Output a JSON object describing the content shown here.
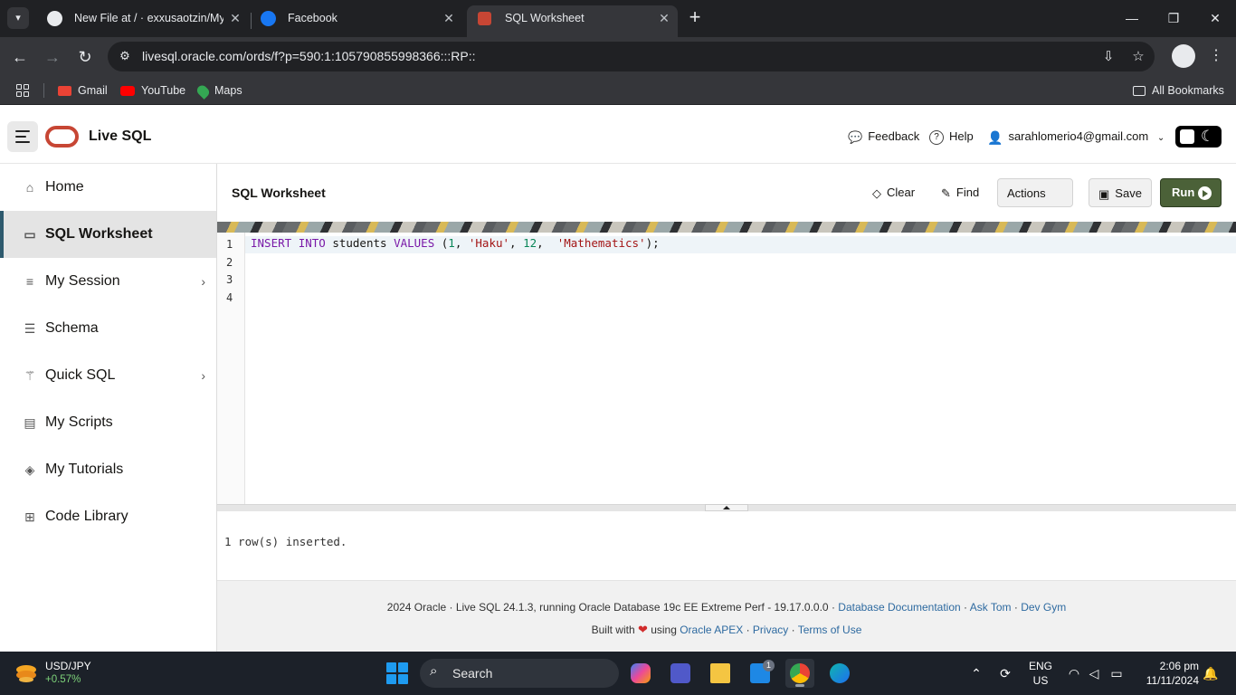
{
  "browser": {
    "tabs": [
      {
        "title": "New File at / · exxusaotzin/My-I",
        "icon": "github-icon"
      },
      {
        "title": "Facebook",
        "icon": "facebook-icon"
      },
      {
        "title": "SQL Worksheet",
        "icon": "terminal-icon",
        "active": true
      }
    ],
    "url": "livesql.oracle.com/ords/f?p=590:1:105790855998366:::RP::",
    "bookmarks": [
      "Gmail",
      "YouTube",
      "Maps"
    ],
    "all_bookmarks": "All Bookmarks"
  },
  "header": {
    "app_title": "Live SQL",
    "feedback": "Feedback",
    "help": "Help",
    "user": "sarahlomerio4@gmail.com"
  },
  "sidebar": {
    "items": [
      {
        "label": "Home",
        "icon": "home-icon"
      },
      {
        "label": "SQL Worksheet",
        "icon": "terminal-icon",
        "active": true
      },
      {
        "label": "My Session",
        "icon": "list-icon",
        "expandable": true
      },
      {
        "label": "Schema",
        "icon": "database-icon"
      },
      {
        "label": "Quick SQL",
        "icon": "wand-icon",
        "expandable": true
      },
      {
        "label": "My Scripts",
        "icon": "script-icon"
      },
      {
        "label": "My Tutorials",
        "icon": "graduation-icon"
      },
      {
        "label": "Code Library",
        "icon": "library-icon"
      }
    ]
  },
  "worksheet": {
    "title": "SQL Worksheet",
    "clear": "Clear",
    "find": "Find",
    "actions": "Actions",
    "save": "Save",
    "run": "Run",
    "line_numbers": [
      "1",
      "2",
      "3",
      "4"
    ],
    "code_tokens": {
      "insert": "INSERT",
      "into": "INTO",
      "table": " students ",
      "values": "VALUES",
      "open": " (",
      "n1": "1",
      "c1": ", ",
      "s1": "'Haku'",
      "c2": ", ",
      "n2": "12",
      "c3": ",  ",
      "s2": "'Mathematics'",
      "close": ");"
    },
    "output": "1 row(s) inserted."
  },
  "footer": {
    "line1": "2024 Oracle · Live SQL 24.1.3, running Oracle Database 19c EE Extreme Perf - 19.17.0.0.0 · ",
    "link_docs": "Database Documentation",
    "sep": " · ",
    "link_asktom": "Ask Tom",
    "link_devgym": "Dev Gym",
    "built_with": "Built with ",
    "using": " using ",
    "link_apex": "Oracle APEX",
    "link_privacy": "Privacy",
    "link_terms": "Terms of Use"
  },
  "taskbar": {
    "ticker_symbol": "USD/JPY",
    "ticker_change": "+0.57%",
    "search": "Search",
    "mail_badge": "1",
    "lang_top": "ENG",
    "lang_bottom": "US",
    "time": "2:06 pm",
    "date": "11/11/2024"
  },
  "colors": {
    "oracle_red": "#c74634",
    "run_green": "#4b6138",
    "sidebar_active_accent": "#2e5a6e"
  }
}
